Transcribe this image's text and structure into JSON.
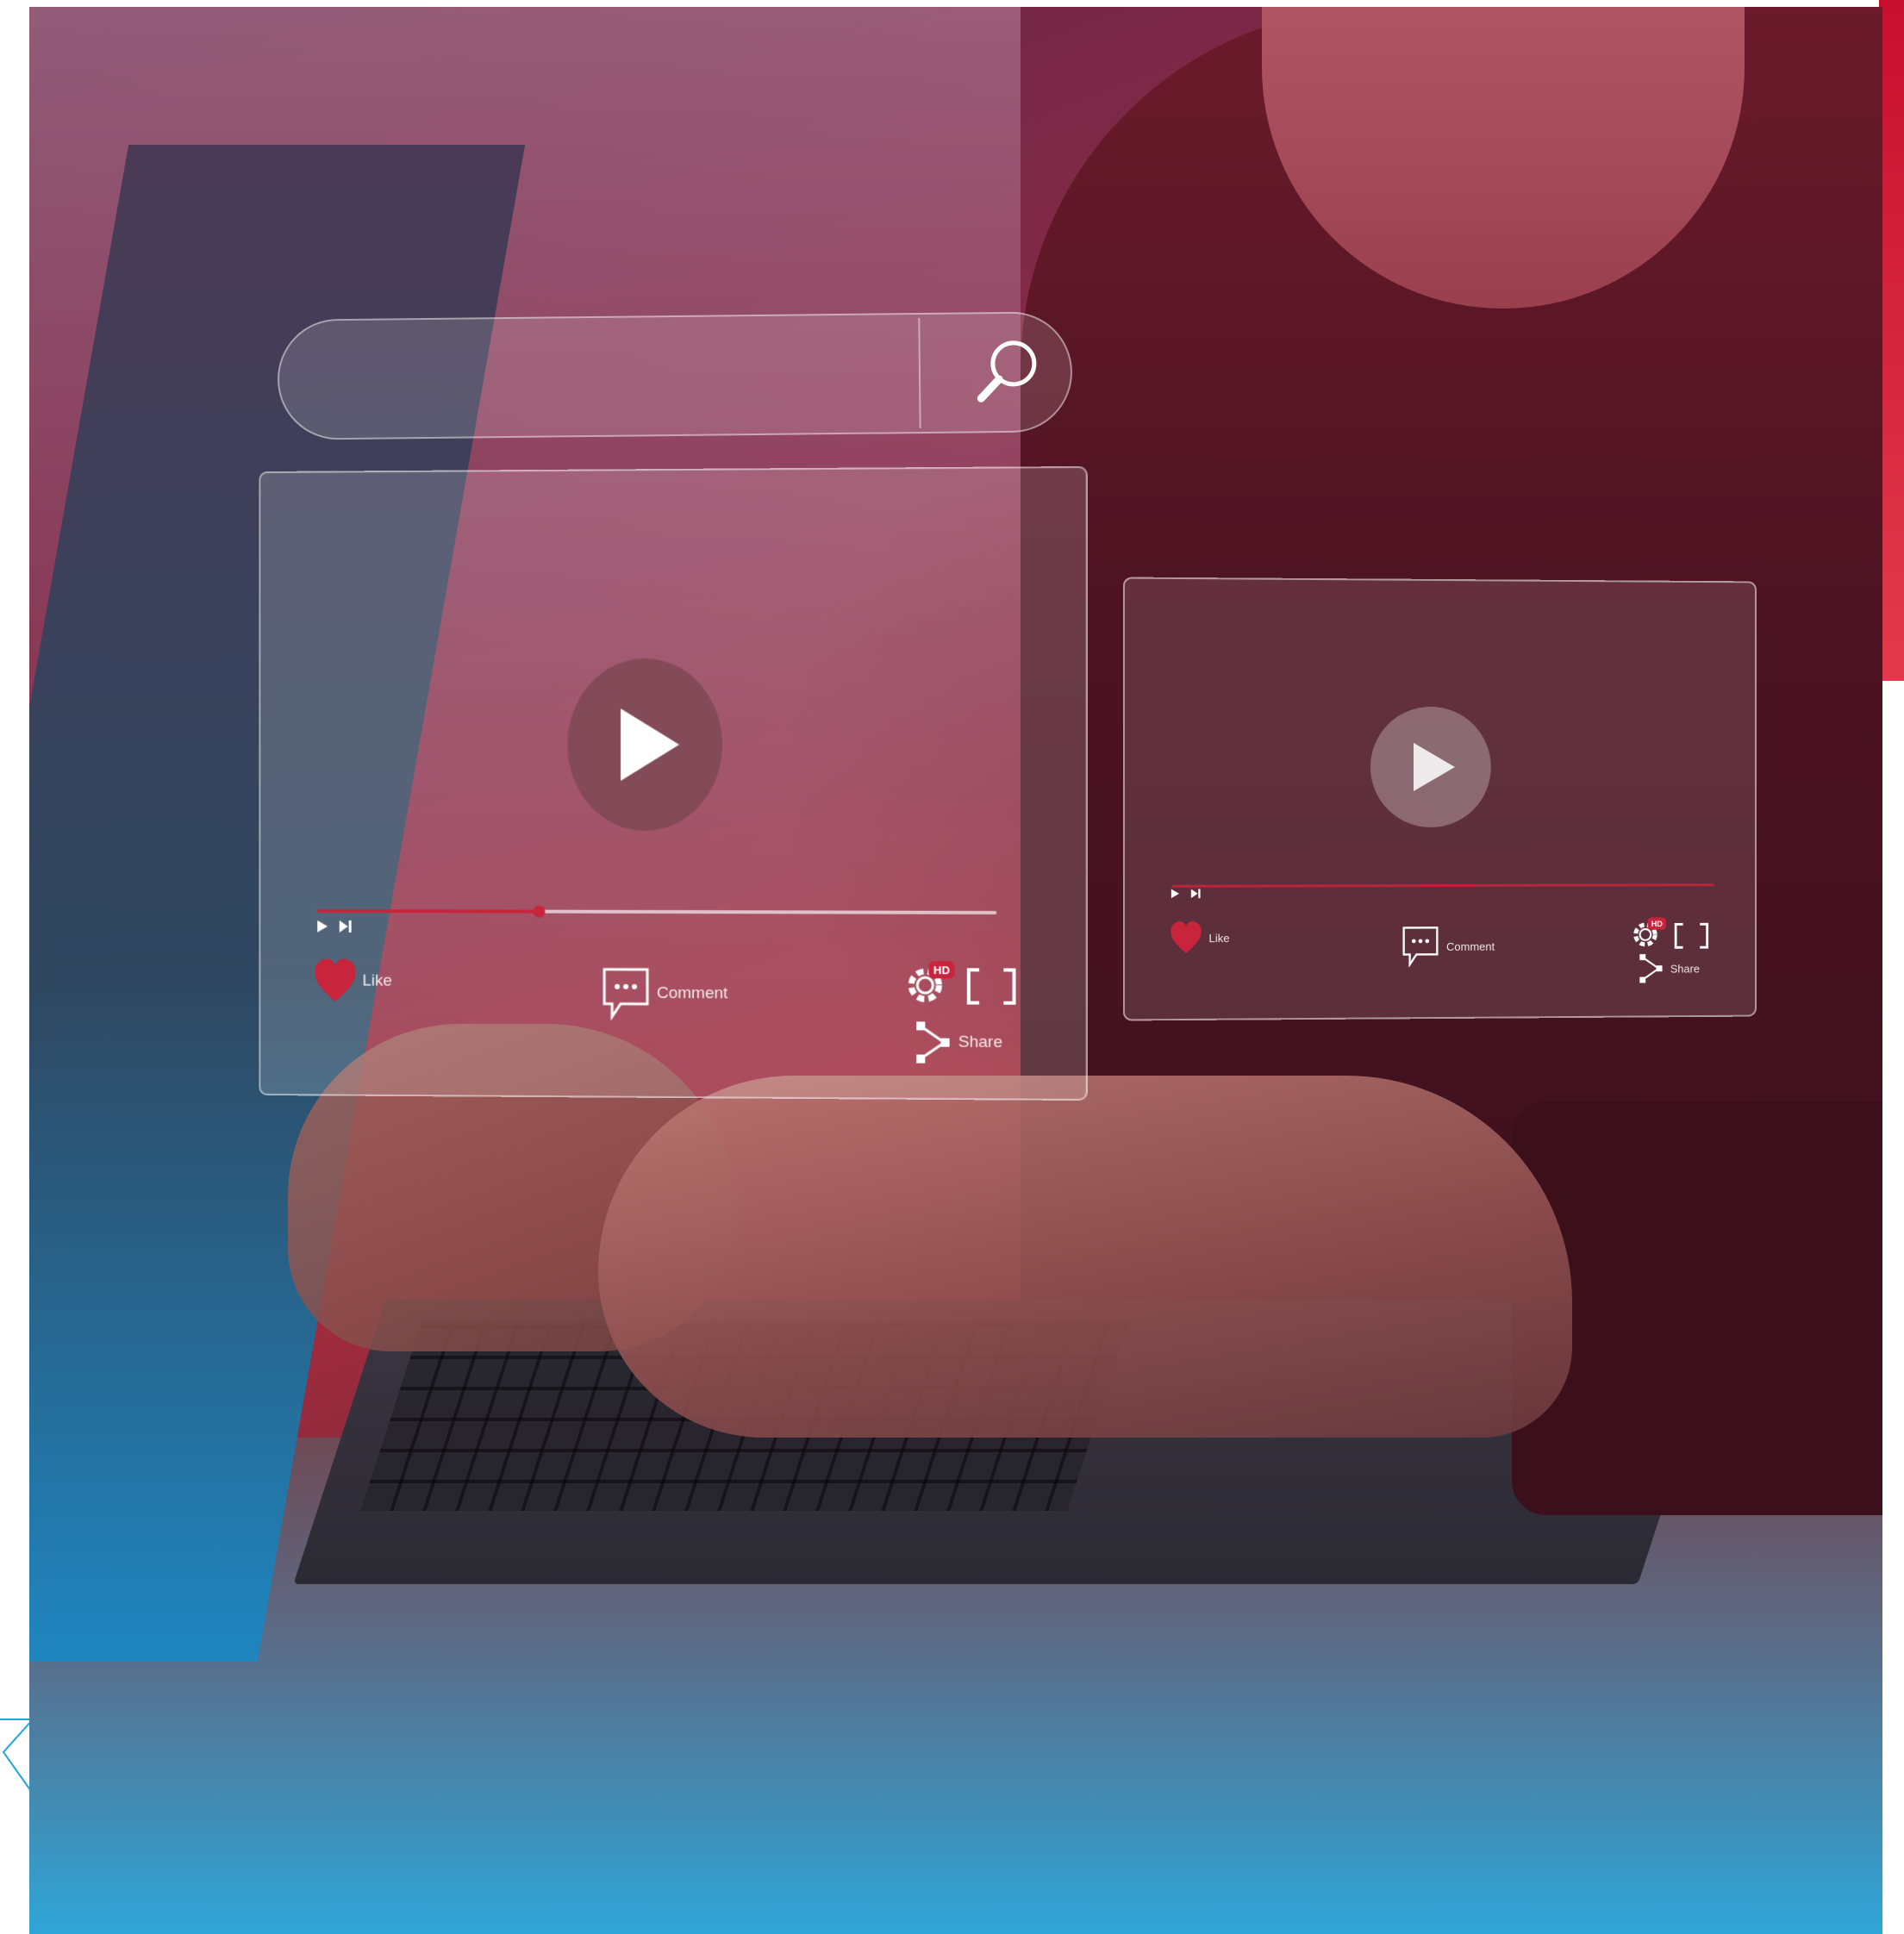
{
  "colors": {
    "accent_red": "#c8102e",
    "accent_blue": "#1ea7e1",
    "heart": "#c8243b",
    "progress": "#c8243b"
  },
  "search": {
    "icon": "search-icon",
    "placeholder": ""
  },
  "players": [
    {
      "id": "main",
      "play_icon": "play-icon",
      "progress_fraction": 0.33,
      "transport_icons": [
        "play-small-icon",
        "skip-next-icon"
      ],
      "like_label": "Like",
      "comment_label": "Comment",
      "share_label": "Share",
      "settings_badge": "HD"
    },
    {
      "id": "side",
      "play_icon": "play-icon",
      "progress_fraction": 0.0,
      "transport_icons": [
        "play-small-icon",
        "skip-next-icon"
      ],
      "like_label": "Like",
      "comment_label": "Comment",
      "share_label": "Share",
      "settings_badge": "HD"
    }
  ]
}
